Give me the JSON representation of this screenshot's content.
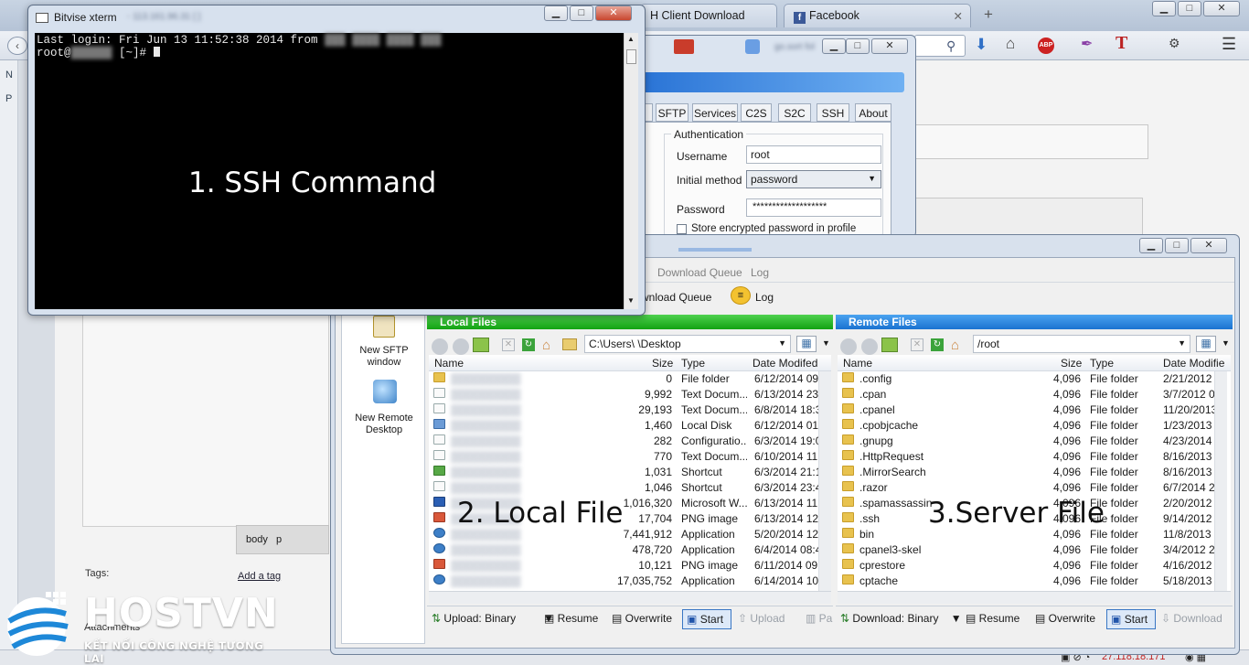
{
  "browser": {
    "tabs": [
      {
        "label": "H Client Download"
      },
      {
        "label": "Facebook"
      }
    ],
    "new_tab": "+",
    "ctrl_buttons": {
      "min": "▁",
      "max": "□",
      "close": "✕"
    },
    "sidebar_letters": [
      "N",
      "P"
    ],
    "editor_path": {
      "body": "body",
      "p": "p"
    },
    "tags_label": "Tags:",
    "add_tag": "Add a tag",
    "attachments": "Attachments",
    "ip_status": "27.118.18.171"
  },
  "tunnelier": {
    "tabs": [
      "SFTP",
      "Services",
      "C2S",
      "S2C",
      "SSH",
      "About"
    ],
    "group_label": "Authentication",
    "username_label": "Username",
    "username_value": "root",
    "method_label": "Initial method",
    "method_value": "password",
    "password_label": "Password",
    "password_value": "*******************",
    "store_label": "Store encrypted password in profile"
  },
  "sftp": {
    "menu": [
      "Download Queue",
      "Log"
    ],
    "toolbar": [
      "wnload Queue",
      "Log"
    ],
    "sidebar": [
      {
        "label": "New SFTP window"
      },
      {
        "label": "New Remote Desktop"
      }
    ],
    "local": {
      "title": "Local Files",
      "path": "C:\\Users\\        \\Desktop",
      "columns": [
        "Name",
        "Size",
        "Type",
        "Date Modifed"
      ],
      "rows": [
        {
          "size": "0",
          "type": "File folder",
          "date": "6/12/2014 09",
          "icon": "folder"
        },
        {
          "size": "9,992",
          "type": "Text Docum...",
          "date": "6/13/2014 23",
          "icon": "file"
        },
        {
          "size": "29,193",
          "type": "Text Docum...",
          "date": "6/8/2014 18:3",
          "icon": "file"
        },
        {
          "size": "1,460",
          "type": "Local Disk",
          "date": "6/12/2014 01",
          "icon": "disk"
        },
        {
          "size": "282",
          "type": "Configuratio...",
          "date": "6/3/2014 19:0",
          "icon": "file"
        },
        {
          "size": "770",
          "type": "Text Docum...",
          "date": "6/10/2014 11",
          "icon": "file"
        },
        {
          "size": "1,031",
          "type": "Shortcut",
          "date": "6/3/2014 21:1",
          "icon": "shortcut"
        },
        {
          "size": "1,046",
          "type": "Shortcut",
          "date": "6/3/2014 23:4",
          "icon": "file"
        },
        {
          "size": "1,016,320",
          "type": "Microsoft W...",
          "date": "6/13/2014 11",
          "icon": "word"
        },
        {
          "size": "17,704",
          "type": "PNG image",
          "date": "6/13/2014 12",
          "icon": "png"
        },
        {
          "size": "7,441,912",
          "type": "Application",
          "date": "5/20/2014 12",
          "icon": "app"
        },
        {
          "size": "478,720",
          "type": "Application",
          "date": "6/4/2014 08:4",
          "icon": "app"
        },
        {
          "size": "10,121",
          "type": "PNG image",
          "date": "6/11/2014 09",
          "icon": "png"
        },
        {
          "size": "17,035,752",
          "type": "Application",
          "date": "6/14/2014 10",
          "icon": "app"
        }
      ],
      "footer": {
        "upload_mode": "Upload: Binary",
        "resume": "Resume",
        "overwrite": "Overwrite",
        "start": "Start",
        "upload": "Upload",
        "pause": "Pa"
      }
    },
    "remote": {
      "title": "Remote Files",
      "path": "/root",
      "columns": [
        "Name",
        "Size",
        "Type",
        "Date Modifie"
      ],
      "rows": [
        {
          "name": ".config",
          "size": "4,096",
          "type": "File folder",
          "date": "2/21/2012"
        },
        {
          "name": ".cpan",
          "size": "4,096",
          "type": "File folder",
          "date": "3/7/2012 0"
        },
        {
          "name": ".cpanel",
          "size": "4,096",
          "type": "File folder",
          "date": "11/20/2013"
        },
        {
          "name": ".cpobjcache",
          "size": "4,096",
          "type": "File folder",
          "date": "1/23/2013 0"
        },
        {
          "name": ".gnupg",
          "size": "4,096",
          "type": "File folder",
          "date": "4/23/2014 0"
        },
        {
          "name": ".HttpRequest",
          "size": "4,096",
          "type": "File folder",
          "date": "8/16/2013"
        },
        {
          "name": ".MirrorSearch",
          "size": "4,096",
          "type": "File folder",
          "date": "8/16/2013"
        },
        {
          "name": ".razor",
          "size": "4,096",
          "type": "File folder",
          "date": "6/7/2014 2"
        },
        {
          "name": ".spamassassin",
          "size": "4,096",
          "type": "File folder",
          "date": "2/20/2012 2"
        },
        {
          "name": ".ssh",
          "size": "4,096",
          "type": "File folder",
          "date": "9/14/2012"
        },
        {
          "name": "bin",
          "size": "4,096",
          "type": "File folder",
          "date": "11/8/2013"
        },
        {
          "name": "cpanel3-skel",
          "size": "4,096",
          "type": "File folder",
          "date": "3/4/2012 2"
        },
        {
          "name": "cprestore",
          "size": "4,096",
          "type": "File folder",
          "date": "4/16/2012 0"
        },
        {
          "name": "cptache",
          "size": "4,096",
          "type": "File folder",
          "date": "5/18/2013"
        }
      ],
      "footer": {
        "download_mode": "Download: Binary",
        "resume": "Resume",
        "overwrite": "Overwrite",
        "start": "Start",
        "download": "Download"
      }
    }
  },
  "xterm": {
    "title": "Bitvise xterm",
    "line1": "Last login: Fri Jun 13 11:52:38 2014 from",
    "prompt_user": "root@",
    "prompt_rest": " [~]# "
  },
  "labels": {
    "ssh": "1. SSH Command",
    "local": "2. Local File",
    "server": "3.Server File"
  },
  "logo": {
    "brand": "HOSTVN",
    "tagline": "KẾT NỐI CÔNG NGHỆ TƯƠNG LAI"
  },
  "colors": {
    "local_header": "#1db01d",
    "remote_header": "#1a7fdc",
    "label_white": "#ffffff",
    "label_black": "#111111"
  }
}
